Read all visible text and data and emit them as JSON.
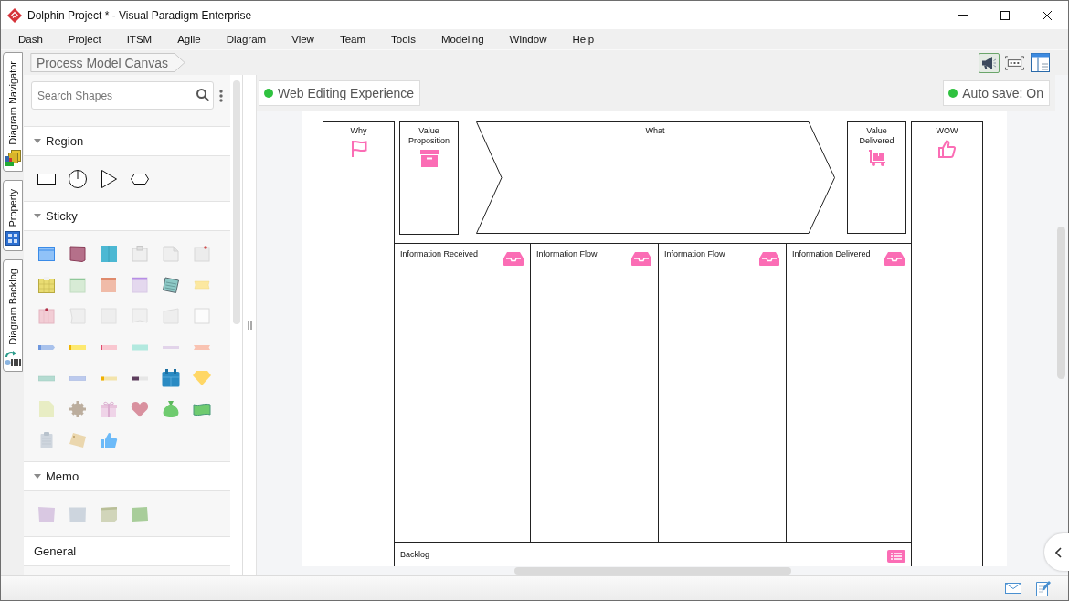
{
  "window": {
    "title": "Dolphin Project * - Visual Paradigm Enterprise"
  },
  "menu": [
    "Dash",
    "Project",
    "ITSM",
    "Agile",
    "Diagram",
    "View",
    "Team",
    "Tools",
    "Modeling",
    "Window",
    "Help"
  ],
  "side_tabs": [
    {
      "label": "Diagram Navigator"
    },
    {
      "label": "Property"
    },
    {
      "label": "Diagram Backlog"
    }
  ],
  "breadcrumb": "Process Model Canvas",
  "toolbar": [
    {
      "selected": true
    },
    {
      "selected": false
    },
    {
      "selected": false
    }
  ],
  "palette": {
    "search": {
      "placeholder": "Search Shapes"
    },
    "sections": [
      {
        "label": "Region",
        "expanded": true
      },
      {
        "label": "Sticky",
        "expanded": true
      },
      {
        "label": "Memo",
        "expanded": true
      },
      {
        "label": "General"
      }
    ]
  },
  "canvas": {
    "badges": [
      "Web Editing Experience",
      "Auto save: On"
    ],
    "diagram": {
      "shapes": [
        {
          "kind": "column",
          "label": "Why"
        },
        {
          "kind": "box",
          "label": "Value Proposition"
        },
        {
          "kind": "chevron",
          "label": "What"
        },
        {
          "kind": "box",
          "label": "Value Delivered"
        },
        {
          "kind": "column",
          "label": "WOW"
        }
      ],
      "lanes": [
        {
          "label": "Information Received"
        },
        {
          "label": "Information Flow"
        },
        {
          "label": "Information Flow"
        },
        {
          "label": "Information Delivered"
        }
      ],
      "backlog": {
        "label": "Backlog"
      }
    }
  }
}
